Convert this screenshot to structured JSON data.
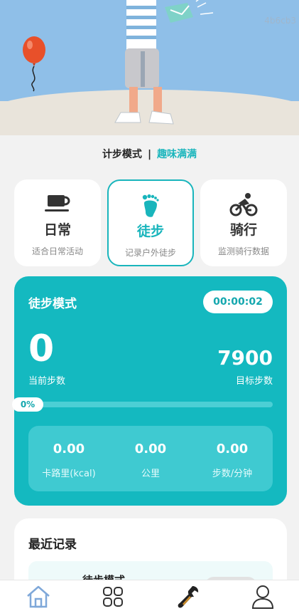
{
  "hero": {
    "watermark": "4b6cb3"
  },
  "mode_line": {
    "left": "计步模式",
    "separator": "|",
    "right": "趣味满满"
  },
  "modes": [
    {
      "title": "日常",
      "desc": "适合日常活动",
      "icon": "cup-icon",
      "active": false
    },
    {
      "title": "徒步",
      "desc": "记录户外徒步",
      "icon": "footprint-icon",
      "active": true
    },
    {
      "title": "骑行",
      "desc": "监测骑行数据",
      "icon": "cycling-icon",
      "active": false
    }
  ],
  "main": {
    "title": "徒步模式",
    "timer": "00:00:02",
    "current_steps": "0",
    "current_label": "当前步数",
    "goal_steps": "7900",
    "goal_label": "目标步数",
    "progress_text": "0%",
    "progress": 0,
    "stats": [
      {
        "value": "0.00",
        "label": "卡路里(kcal)"
      },
      {
        "value": "0.00",
        "label": "公里"
      },
      {
        "value": "0.00",
        "label": "步数/分钟"
      }
    ]
  },
  "recent": {
    "title": "最近记录",
    "item_title": "徒步模式"
  },
  "tabs": [
    {
      "name": "home-icon"
    },
    {
      "name": "grid-icon"
    },
    {
      "name": "wrench-icon"
    },
    {
      "name": "user-icon"
    }
  ],
  "colors": {
    "accent": "#14b9c0",
    "hero_sky": "#8fbfe8",
    "balloon": "#e8502a"
  }
}
